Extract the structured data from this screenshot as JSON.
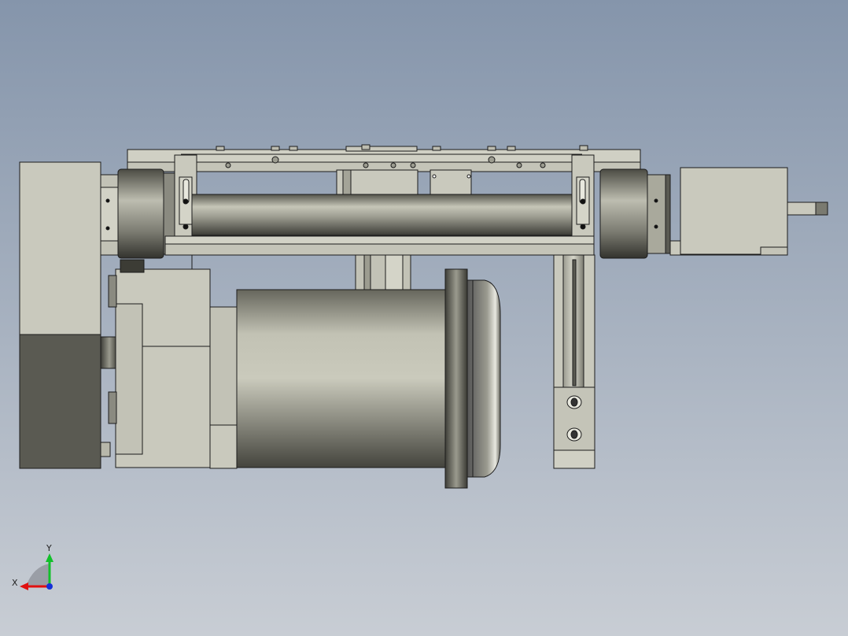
{
  "viewport": {
    "background_top": "#8595ab",
    "background_bottom": "#c8cdd4",
    "part_fill": "#c9c9bd",
    "part_edge": "#1c1c1c",
    "shadow_fill": "#5a5a52"
  },
  "triad": {
    "x_label": "X",
    "y_label": "Y",
    "x_color": "#e01010",
    "y_color": "#12c02a",
    "z_color": "#1530d8"
  }
}
